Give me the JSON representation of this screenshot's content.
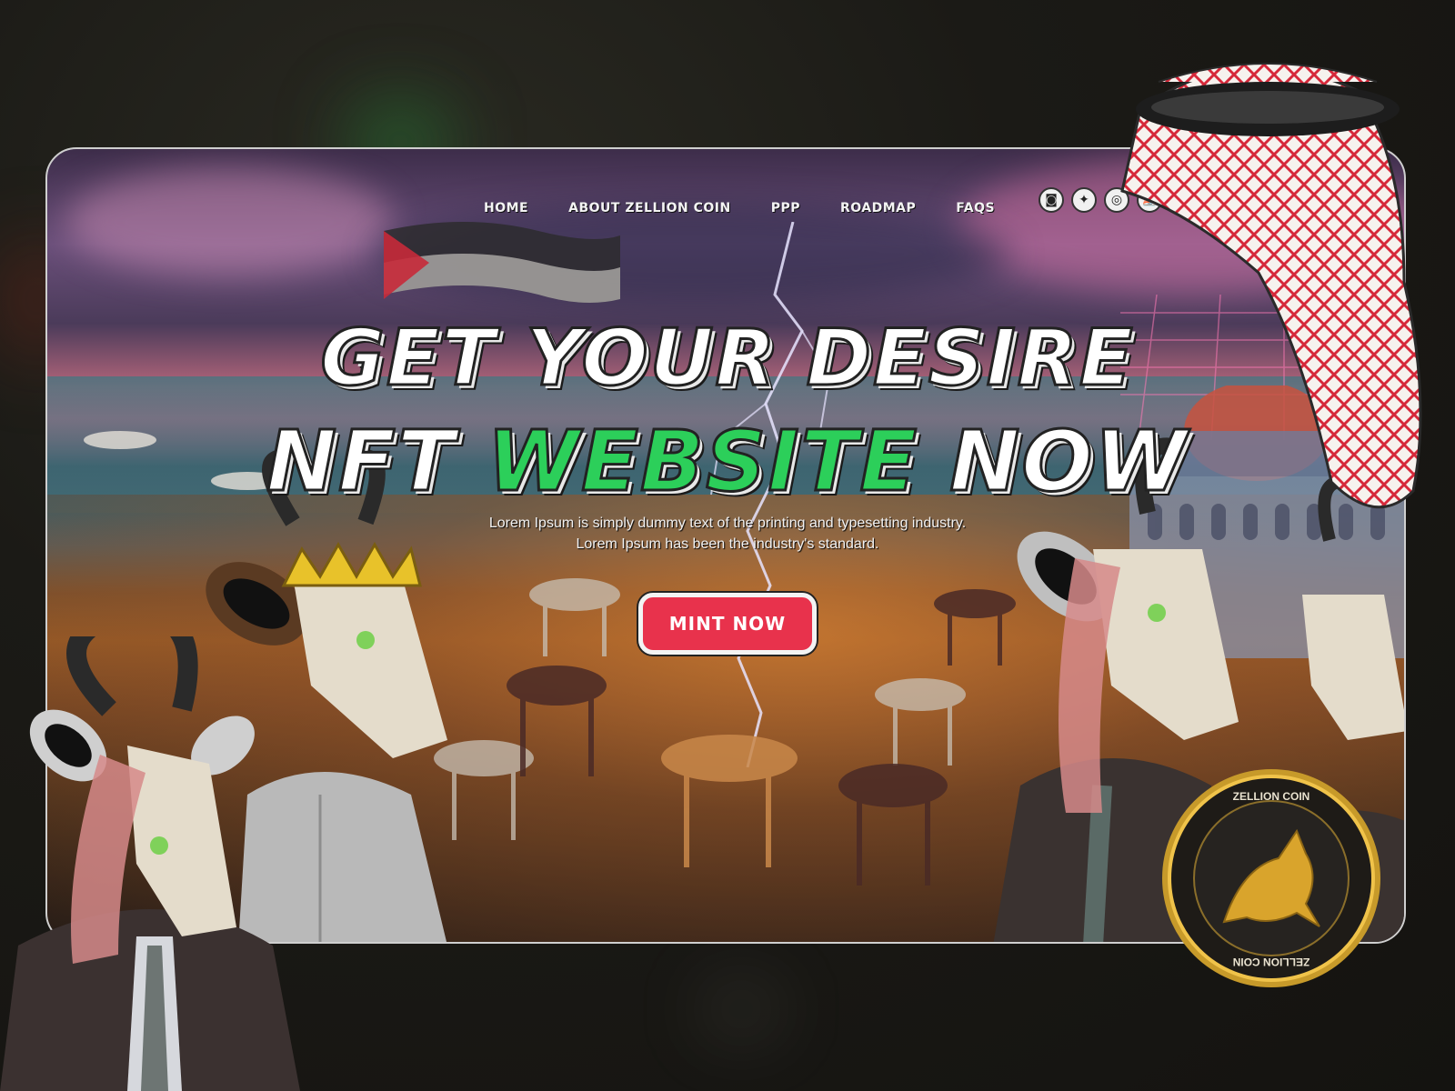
{
  "nav": {
    "items": [
      "HOME",
      "ABOUT ZELLION COIN",
      "PPP",
      "ROADMAP",
      "FAQS"
    ]
  },
  "socials": [
    {
      "icon": "discord-icon",
      "glyph": "◙"
    },
    {
      "icon": "twitter-icon",
      "glyph": "✦"
    },
    {
      "icon": "instagram-icon",
      "glyph": "◎"
    },
    {
      "icon": "opensea-icon",
      "glyph": "⛵"
    },
    {
      "icon": "medium-icon",
      "glyph": "●●"
    }
  ],
  "hero": {
    "line1": "GET YOUR DESIRE",
    "line2_a": "NFT ",
    "line2_highlight": "WEBSITE",
    "line2_b": " NOW",
    "subtitle_1": "Lorem Ipsum is simply dummy text of the printing and typesetting industry.",
    "subtitle_2": "Lorem Ipsum has been the industry's standard.",
    "cta_label": "MINT NOW"
  },
  "coin": {
    "ring_text": "ZELLION COIN"
  },
  "colors": {
    "accent_green": "#2ccf5a",
    "cta_red": "#e8324c"
  }
}
